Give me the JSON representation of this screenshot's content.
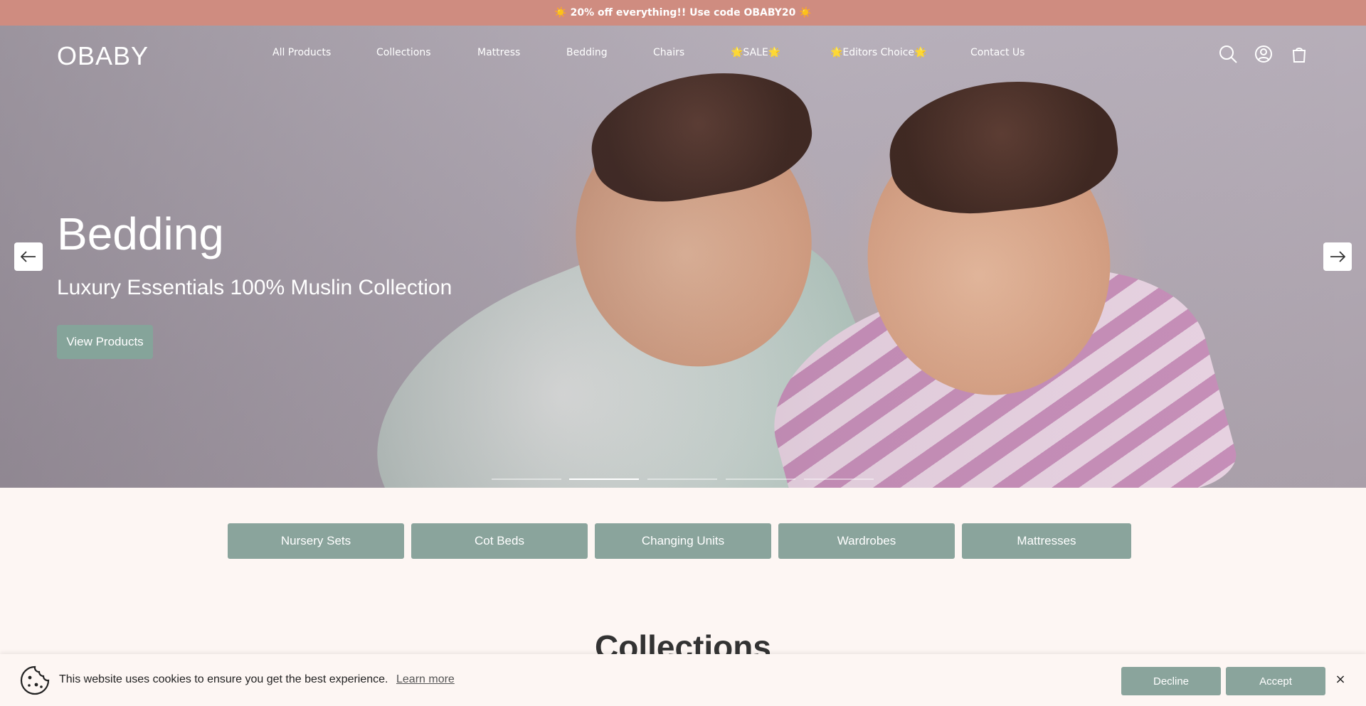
{
  "announcement": {
    "text": "☀️ 20% off everything!! Use code OBABY20 ☀️"
  },
  "header": {
    "logo": "OBABY",
    "nav": [
      {
        "label": "All Products"
      },
      {
        "label": "Collections"
      },
      {
        "label": "Mattress"
      },
      {
        "label": "Bedding"
      },
      {
        "label": "Chairs"
      },
      {
        "label": "🌟SALE🌟"
      },
      {
        "label": "🌟Editors Choice🌟"
      },
      {
        "label": "Contact Us"
      }
    ],
    "icons": [
      "search-icon",
      "account-icon",
      "cart-icon"
    ]
  },
  "hero": {
    "title": "Bedding",
    "subtitle": "Luxury Essentials 100% Muslin Collection",
    "button": "View Products",
    "slides_count": 5,
    "active_slide": 2
  },
  "categories": [
    {
      "label": "Nursery Sets"
    },
    {
      "label": "Cot Beds"
    },
    {
      "label": "Changing Units"
    },
    {
      "label": "Wardrobes"
    },
    {
      "label": "Mattresses"
    }
  ],
  "collections": {
    "title": "Collections"
  },
  "cookie": {
    "text": "This website uses cookies to ensure you get the best experience.",
    "learn_more": "Learn more",
    "decline": "Decline",
    "accept": "Accept",
    "close": "×"
  },
  "colors": {
    "announcement_bg": "#cf8c80",
    "accent": "#8aa49c",
    "page_bg": "#fdf6f3"
  }
}
